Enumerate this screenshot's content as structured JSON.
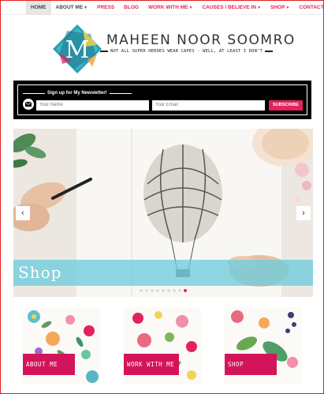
{
  "nav": {
    "items": [
      {
        "label": "Home",
        "active": true,
        "dropdown": false
      },
      {
        "label": "About Me",
        "active": false,
        "dropdown": true
      },
      {
        "label": "Press",
        "active": false,
        "dropdown": false
      },
      {
        "label": "Blog",
        "active": false,
        "dropdown": false
      },
      {
        "label": "Work With Me",
        "active": false,
        "dropdown": true
      },
      {
        "label": "Causes I Believe In",
        "active": false,
        "dropdown": true
      },
      {
        "label": "Shop",
        "active": false,
        "dropdown": true
      },
      {
        "label": "Contact",
        "active": false,
        "dropdown": false
      }
    ]
  },
  "header": {
    "logo_letter": "M",
    "brand": "MAHEEN NOOR SOOMRO",
    "tagline": "NOT ALL SUPER HEROES WEAR CAPES - WELL, AT LEAST I DON'T"
  },
  "newsletter": {
    "title": "Sign up for My Newsletter!",
    "name_placeholder": "Your Name",
    "email_placeholder": "Your Email",
    "button": "SUBSCRIBE"
  },
  "slider": {
    "caption": "Shop",
    "prev": "‹",
    "next": "›",
    "slide_count": 9,
    "active_slide": 8
  },
  "tiles": [
    {
      "label": "ABOUT ME"
    },
    {
      "label": "WORK WITH ME"
    },
    {
      "label": "SHOP"
    }
  ],
  "colors": {
    "accent": "#e0245e",
    "tile_label": "#d4145a",
    "slide_bar": "#6ecddc"
  }
}
